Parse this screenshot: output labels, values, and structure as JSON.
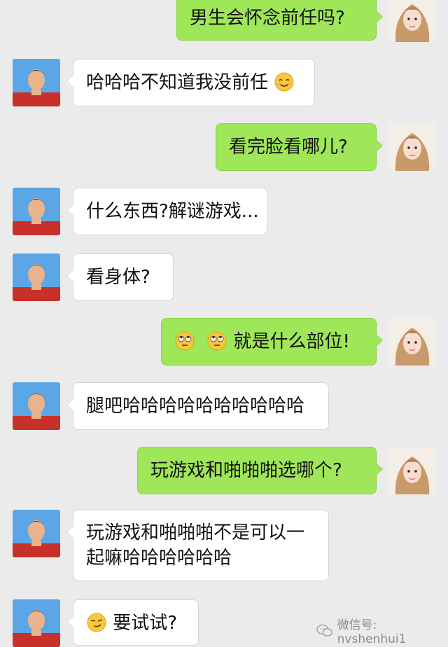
{
  "messages": [
    {
      "side": "right",
      "text": "男生会怀念前任吗?"
    },
    {
      "side": "left",
      "text": "哈哈哈不知道我没前任",
      "emoji_after": "smiling-face-icon"
    },
    {
      "side": "right",
      "text": "看完脸看哪儿?"
    },
    {
      "side": "left",
      "text": "什么东西?解谜游戏..."
    },
    {
      "side": "left",
      "text": "看身体?"
    },
    {
      "side": "right",
      "text": "就是什么部位!",
      "emoji_before": [
        "eye-roll-face-icon",
        "eye-roll-face-icon"
      ]
    },
    {
      "side": "left",
      "text": "腿吧哈哈哈哈哈哈哈哈哈哈"
    },
    {
      "side": "right",
      "text": "玩游戏和啪啪啪选哪个?"
    },
    {
      "side": "left",
      "text_line1": "玩游戏和啪啪啪不是可以一",
      "text_line2": "起嘛哈哈哈哈哈哈"
    },
    {
      "side": "left",
      "text": "要试试?",
      "emoji_before": [
        "smirk-face-icon"
      ]
    }
  ],
  "watermark": {
    "text": "微信号: nvshenhui1",
    "icon": "wechat-icon"
  },
  "colors": {
    "background": "#ebebeb",
    "sent_bubble": "#9fe658",
    "received_bubble": "#ffffff"
  }
}
